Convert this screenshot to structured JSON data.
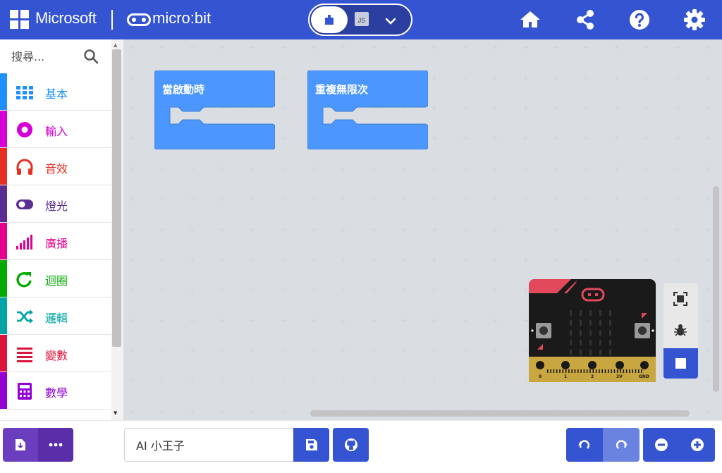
{
  "header": {
    "brand": "Microsoft",
    "product": "micro:bit",
    "editor_toggle": {
      "blocks": "blocks-icon",
      "js_label": "JS",
      "dropdown": "chevron-down-icon"
    },
    "icons": [
      "home-icon",
      "share-icon",
      "help-icon",
      "gear-icon"
    ],
    "color": "#3454d1"
  },
  "toolbox": {
    "search_placeholder": "搜尋...",
    "categories": [
      {
        "label": "基本",
        "color": "#1e90ff",
        "icon": "grid-icon"
      },
      {
        "label": "輸入",
        "color": "#d400d4",
        "icon": "target-icon"
      },
      {
        "label": "音效",
        "color": "#e63022",
        "icon": "headphones-icon"
      },
      {
        "label": "燈光",
        "color": "#5c2d91",
        "icon": "toggle-icon"
      },
      {
        "label": "廣播",
        "color": "#e3008c",
        "icon": "signal-bars-icon"
      },
      {
        "label": "迴圈",
        "color": "#00aa00",
        "icon": "loop-arrow-icon"
      },
      {
        "label": "邏輯",
        "color": "#00a4a6",
        "icon": "shuffle-icon"
      },
      {
        "label": "變數",
        "color": "#dc143c",
        "icon": "list-icon"
      },
      {
        "label": "數學",
        "color": "#9400d3",
        "icon": "calculator-icon"
      }
    ]
  },
  "workspace": {
    "blocks": [
      {
        "label": "當啟動時",
        "color": "#4c97ff"
      },
      {
        "label": "重複無限次",
        "color": "#4c97ff"
      }
    ]
  },
  "simulator": {
    "pin_labels": [
      "0",
      "1",
      "2",
      "3V",
      "GND"
    ],
    "tools": [
      "fullscreen-icon",
      "bug-icon",
      "stop-icon"
    ]
  },
  "footer": {
    "project_name": "AI 小王子",
    "buttons": [
      "download-icon",
      "more-dots-icon",
      "save-icon",
      "github-icon",
      "undo-icon",
      "redo-icon",
      "zoom-out-icon",
      "zoom-in-icon"
    ]
  }
}
